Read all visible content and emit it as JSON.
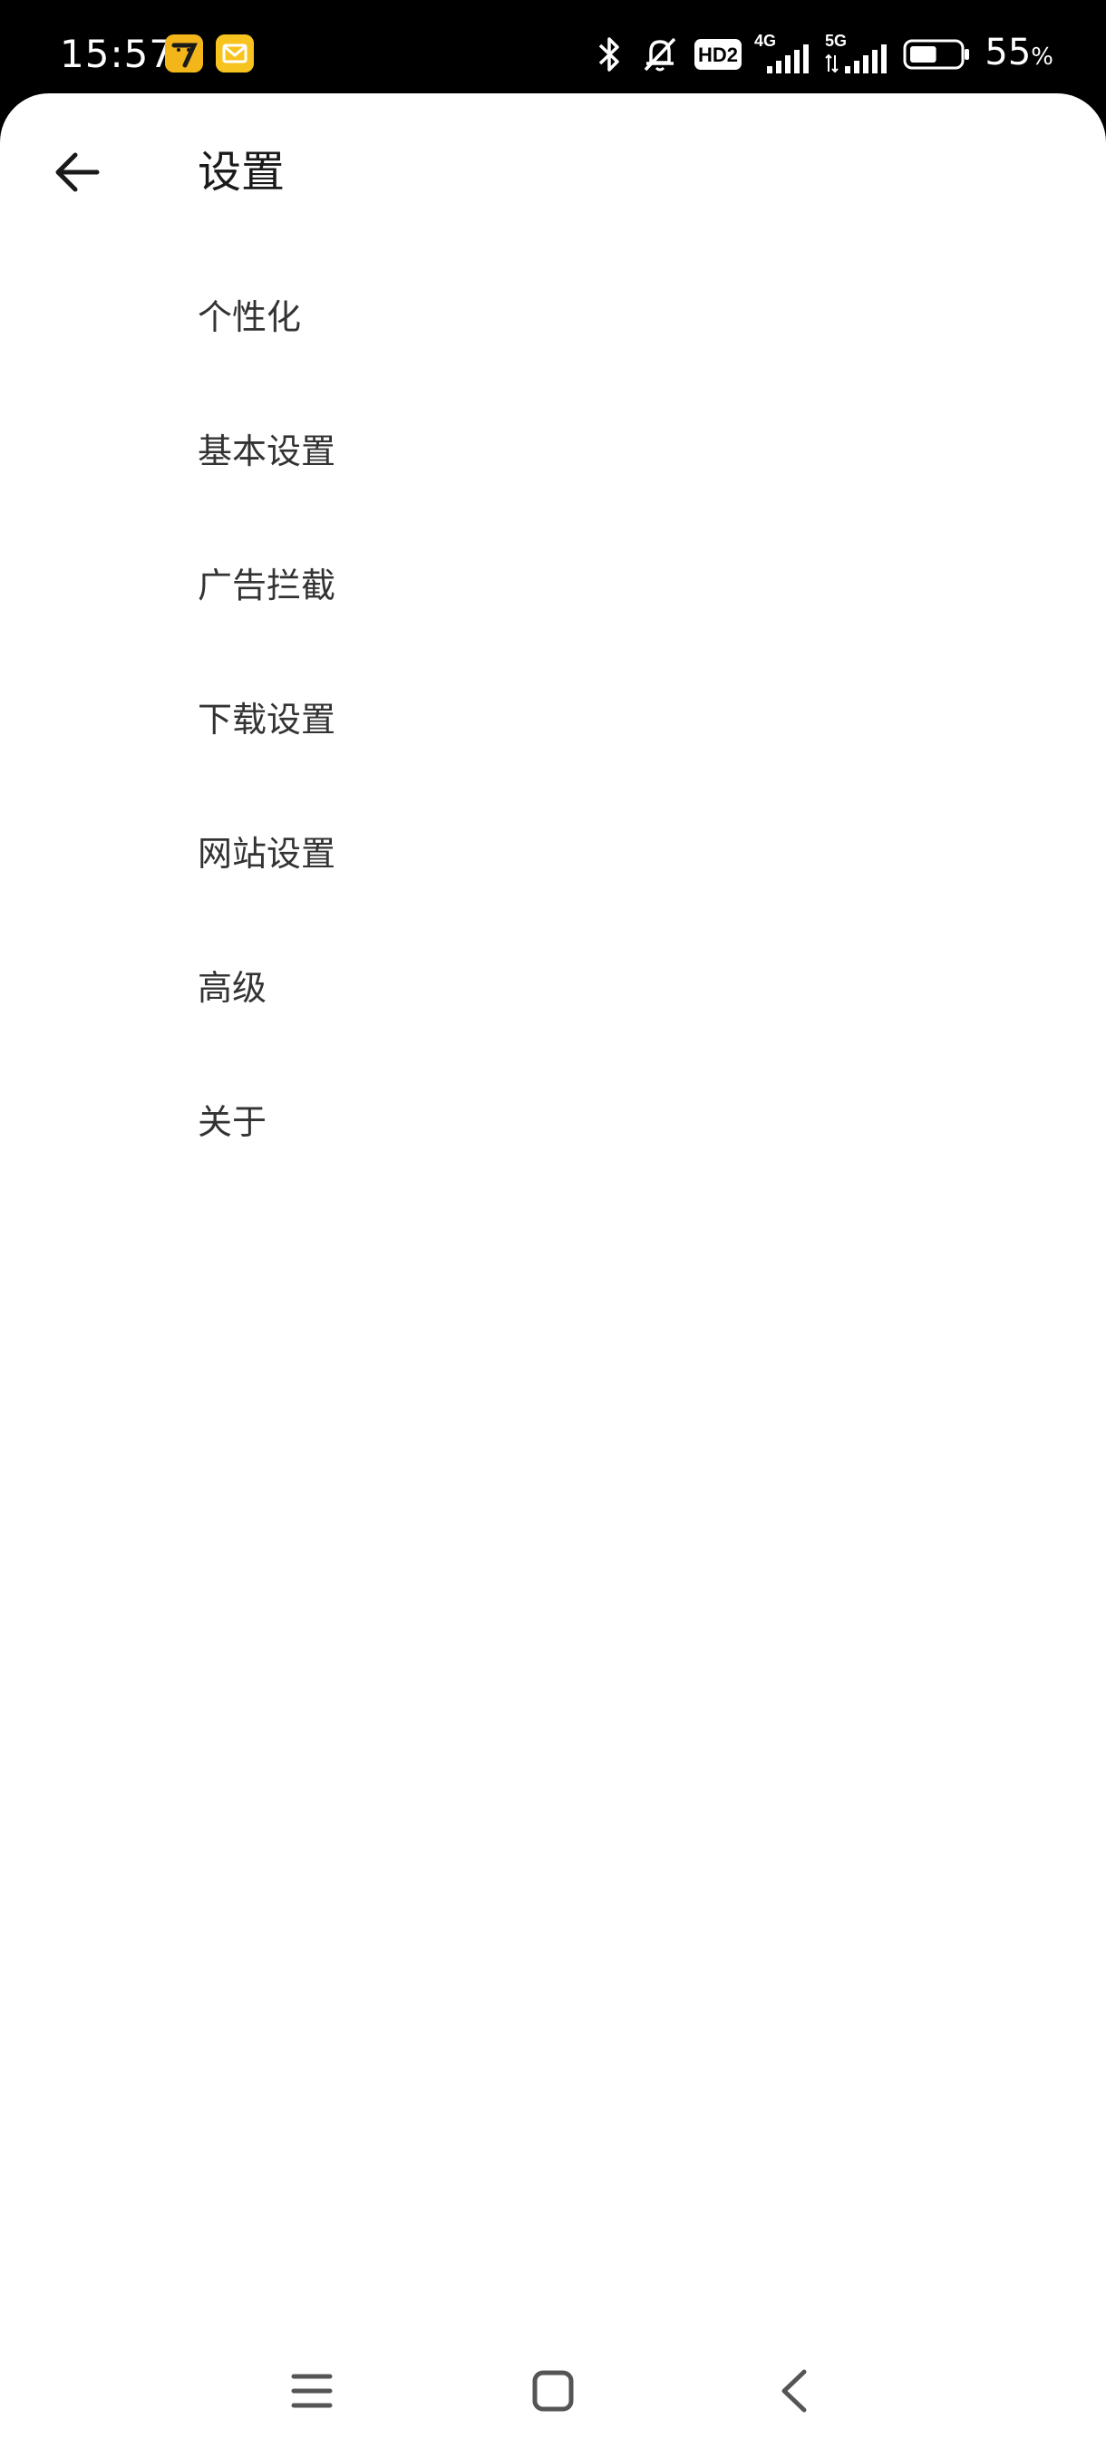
{
  "status_bar": {
    "time": "15:57",
    "network_badge": "HD2",
    "net_4g": "4G",
    "net_5g": "5G",
    "battery_percent": "55",
    "battery_unit": "%",
    "battery_level": 0.55,
    "icons": [
      "app-icon-7",
      "mail-app-icon",
      "bluetooth-icon",
      "silent-bell-icon",
      "signal-icon",
      "battery-icon"
    ]
  },
  "header": {
    "title": "设置",
    "back_icon": "arrow-left-icon"
  },
  "menu": {
    "items": [
      {
        "label": "个性化"
      },
      {
        "label": "基本设置"
      },
      {
        "label": "广告拦截"
      },
      {
        "label": "下载设置"
      },
      {
        "label": "网站设置"
      },
      {
        "label": "高级"
      },
      {
        "label": "关于"
      }
    ]
  },
  "nav_bar": {
    "icons": [
      "menu-lines-icon",
      "home-square-icon",
      "back-chevron-icon"
    ]
  },
  "colors": {
    "status_bg": "#000000",
    "sheet_bg": "#ffffff",
    "title_text": "#1a1a1a",
    "item_text": "#333333"
  }
}
